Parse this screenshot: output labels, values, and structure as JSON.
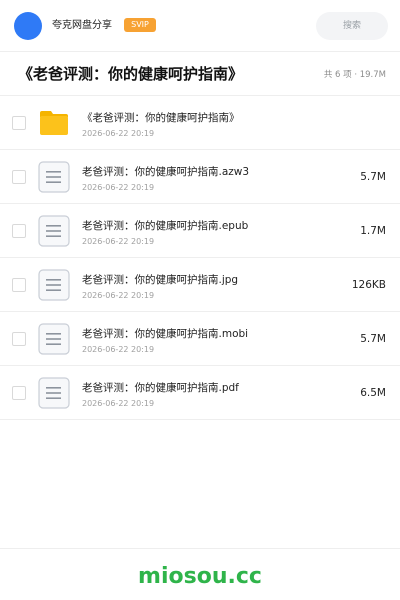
{
  "header": {
    "brand": "夸克网盘分享",
    "badge": "SVIP",
    "search_label": "搜索"
  },
  "share": {
    "title": "《老爸评测：你的健康呵护指南》",
    "meta": "共 6 项 · 19.7M"
  },
  "files": [
    {
      "icon": "folder-icon",
      "name": "《老爸评测：你的健康呵护指南》",
      "date": "2026-06-22 20:19",
      "size": ""
    },
    {
      "icon": "document-icon",
      "name": "老爸评测：你的健康呵护指南.azw3",
      "date": "2026-06-22 20:19",
      "size": "5.7M"
    },
    {
      "icon": "document-icon",
      "name": "老爸评测：你的健康呵护指南.epub",
      "date": "2026-06-22 20:19",
      "size": "1.7M"
    },
    {
      "icon": "document-icon",
      "name": "老爸评测：你的健康呵护指南.jpg",
      "date": "2026-06-22 20:19",
      "size": "126KB"
    },
    {
      "icon": "document-icon",
      "name": "老爸评测：你的健康呵护指南.mobi",
      "date": "2026-06-22 20:19",
      "size": "5.7M"
    },
    {
      "icon": "document-icon",
      "name": "老爸评测：你的健康呵护指南.pdf",
      "date": "2026-06-22 20:19",
      "size": "6.5M"
    }
  ],
  "footer": {
    "watermark": "miosou.cc"
  },
  "colors": {
    "avatar": "#2f7af6",
    "badge": "#f7a233",
    "folder": "#fcc21b",
    "watermark": "#2fb44a"
  }
}
